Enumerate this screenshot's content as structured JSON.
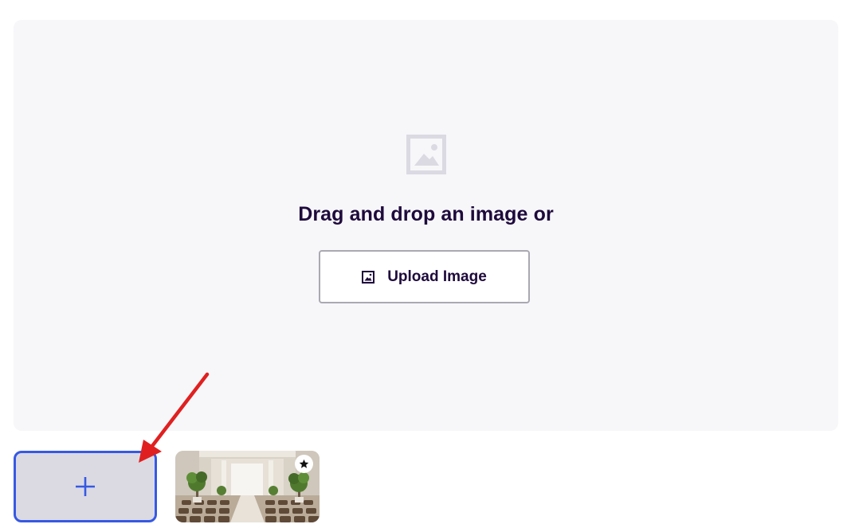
{
  "dropzone": {
    "icon": "image-placeholder-icon",
    "prompt": "Drag and drop an image or",
    "upload_button": {
      "label": "Upload Image",
      "icon": "image-icon"
    }
  },
  "gallery": {
    "add_tile": {
      "icon": "plus-icon"
    },
    "thumbnails": [
      {
        "icon": "star-icon",
        "featured": true
      }
    ]
  },
  "annotation": {
    "icon": "red-arrow",
    "color": "#e02020"
  },
  "colors": {
    "text": "#1e0a3c",
    "accent": "#3659e3",
    "dropzone_bg": "#f7f7f9"
  }
}
